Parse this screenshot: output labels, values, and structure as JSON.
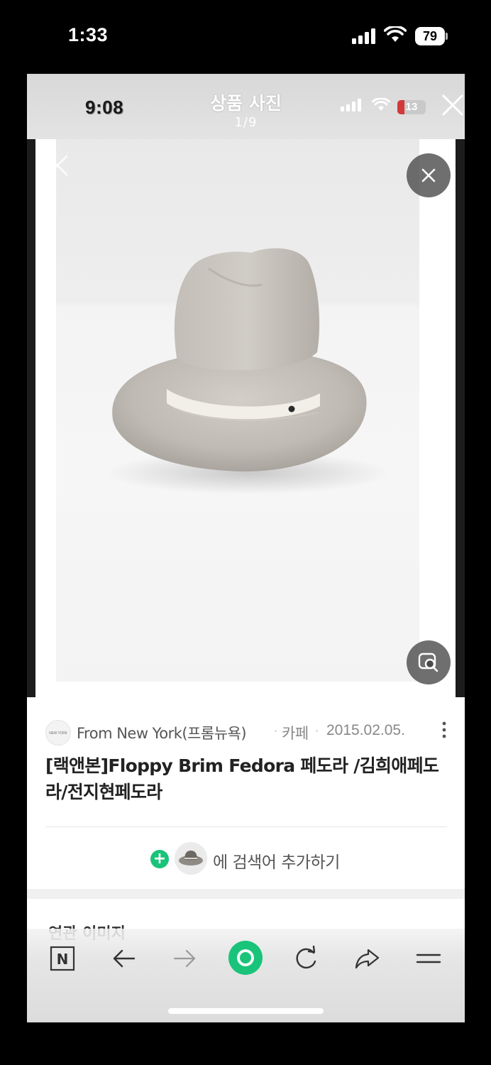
{
  "status_bar": {
    "time": "1:33",
    "battery": "79",
    "icons": [
      "cellular-signal-icon",
      "wifi-icon",
      "battery-icon"
    ]
  },
  "viewer": {
    "inner_time": "9:08",
    "inner_battery": "13",
    "title": "상품 사진",
    "counter": "1/9",
    "icons": [
      "close-icon",
      "close-round-icon",
      "image-search-icon"
    ]
  },
  "result": {
    "source_logo_text": "NEW YORK",
    "source_name": "From New York(프롬뉴욕)",
    "source_type": "카페",
    "separator": "·",
    "date": "2015.02.05.",
    "title": "[랙앤본]Floppy Brim Fedora 페도라 /김희애페도라/전지현페도라",
    "add_prefix": "+",
    "add_text": "에 검색어 추가하기"
  },
  "related": {
    "title": "연관 이미지"
  },
  "toolbar": {
    "home_letter": "N",
    "buttons": [
      "naver-home-icon",
      "back-arrow-icon",
      "forward-arrow-icon",
      "green-dot-icon",
      "reload-icon",
      "share-icon",
      "menu-icon"
    ]
  },
  "colors": {
    "accent_green": "#19c37a",
    "hat": "#c4bfb8",
    "hat_band": "#f2efe9"
  }
}
